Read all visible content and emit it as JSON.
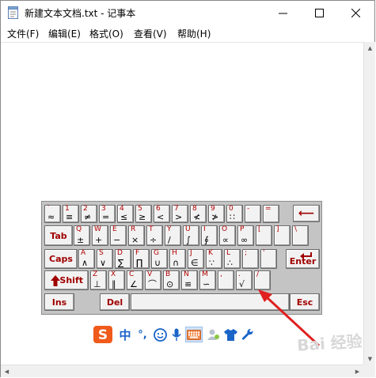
{
  "window": {
    "title": "新建文本文档.txt - 记事本",
    "controls": {
      "minimize": "—",
      "maximize": "☐",
      "close": "✕"
    }
  },
  "menu": [
    {
      "label": "文件(F)"
    },
    {
      "label": "编辑(E)"
    },
    {
      "label": "格式(O)"
    },
    {
      "label": "查看(V)"
    },
    {
      "label": "帮助(H)"
    }
  ],
  "keyboard": {
    "row1": [
      {
        "top": "`",
        "bot": "≈"
      },
      {
        "top": "1",
        "bot": "≡"
      },
      {
        "top": "2",
        "bot": "≠"
      },
      {
        "top": "3",
        "bot": "="
      },
      {
        "top": "4",
        "bot": "≤"
      },
      {
        "top": "5",
        "bot": "≥"
      },
      {
        "top": "6",
        "bot": "<"
      },
      {
        "top": "7",
        "bot": ">"
      },
      {
        "top": "8",
        "bot": "≮"
      },
      {
        "top": "9",
        "bot": "≯"
      },
      {
        "top": "0",
        "bot": "∷"
      },
      {
        "top": "-",
        "bot": ""
      },
      {
        "top": "=",
        "bot": ""
      }
    ],
    "backspace": "⟵",
    "tab": "Tab",
    "row2": [
      {
        "top": "Q",
        "bot": "±"
      },
      {
        "top": "W",
        "bot": "+"
      },
      {
        "top": "E",
        "bot": "−"
      },
      {
        "top": "R",
        "bot": "×"
      },
      {
        "top": "T",
        "bot": "÷"
      },
      {
        "top": "Y",
        "bot": "/"
      },
      {
        "top": "U",
        "bot": "∫"
      },
      {
        "top": "I",
        "bot": "∮"
      },
      {
        "top": "O",
        "bot": "∝"
      },
      {
        "top": "P",
        "bot": "∞"
      },
      {
        "top": "[",
        "bot": ""
      },
      {
        "top": "]",
        "bot": ""
      },
      {
        "top": "\\",
        "bot": ""
      }
    ],
    "caps": "Caps",
    "row3": [
      {
        "top": "A",
        "bot": "∧"
      },
      {
        "top": "S",
        "bot": "∨"
      },
      {
        "top": "D",
        "bot": "∑"
      },
      {
        "top": "F",
        "bot": "∏"
      },
      {
        "top": "G",
        "bot": "∪"
      },
      {
        "top": "H",
        "bot": "∩"
      },
      {
        "top": "J",
        "bot": "∈"
      },
      {
        "top": "K",
        "bot": "∵"
      },
      {
        "top": "L",
        "bot": "∴"
      },
      {
        "top": ";",
        "bot": ""
      },
      {
        "top": "'",
        "bot": ""
      }
    ],
    "enter": "Enter",
    "shift": "Shift",
    "row4": [
      {
        "top": "Z",
        "bot": "⊥"
      },
      {
        "top": "X",
        "bot": "∥"
      },
      {
        "top": "C",
        "bot": "∠"
      },
      {
        "top": "V",
        "bot": "⌒"
      },
      {
        "top": "B",
        "bot": "⊙"
      },
      {
        "top": "N",
        "bot": "≌"
      },
      {
        "top": "M",
        "bot": "∽"
      },
      {
        "top": ",",
        "bot": ""
      },
      {
        "top": ".",
        "bot": "√"
      },
      {
        "top": "/",
        "bot": ""
      }
    ],
    "ins": "Ins",
    "del": "Del",
    "esc": "Esc"
  },
  "ime": {
    "logo": "S",
    "mode": "中",
    "punct": "°,",
    "emoji": "☺",
    "voice": "mic",
    "softkbd": "keyboard",
    "user": "user",
    "skin": "shirt",
    "tools": "wrench"
  },
  "watermark": "Bai 经验",
  "colors": {
    "key_label": "#a00000",
    "arrow": "#e02020",
    "ime_logo": "#f05a1a",
    "ime_blue": "#1a64c8"
  }
}
